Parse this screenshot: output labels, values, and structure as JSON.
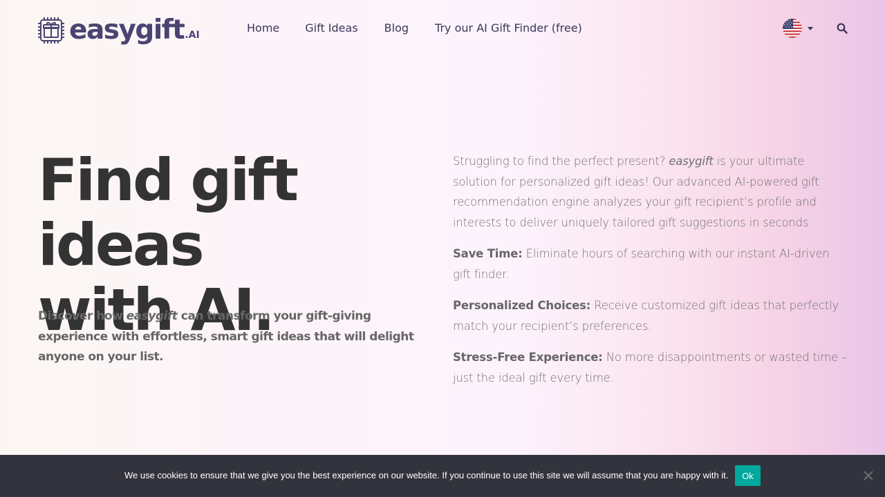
{
  "header": {
    "logo": {
      "word": "easygift",
      "suffix": ".AI"
    },
    "nav": [
      {
        "label": "Home"
      },
      {
        "label": "Gift Ideas"
      },
      {
        "label": "Blog"
      },
      {
        "label": "Try our AI Gift Finder (free)"
      }
    ],
    "language": {
      "icon": "us-flag-icon"
    },
    "search_icon": "search-icon"
  },
  "hero": {
    "title_line1": "Find gift ideas",
    "title_line2": "with AI.",
    "subtitle_pre": "Discover how ",
    "subtitle_brand": "easygift",
    "subtitle_post": " can transform your gift-giving experience with effortless, smart gift ideas that will delight anyone on your list."
  },
  "intro": {
    "p1_pre": "Struggling to find the perfect present? ",
    "p1_brand": "easygift",
    "p1_post": " is your ultimate solution for personalized gift ideas! Our advanced AI-powered gift recommendation engine analyzes your gift recipient’s profile and interests to deliver uniquely tailored gift suggestions in seconds.",
    "features": [
      {
        "label": "Save Time:",
        "text": " Eliminate hours of searching with our instant AI-driven gift finder."
      },
      {
        "label": "Personalized Choices:",
        "text": " Receive customized gift ideas that perfectly match your recipient’s preferences."
      },
      {
        "label": "Stress-Free Experience:",
        "text": " No more disappointments or wasted time – just the ideal gift every time."
      }
    ]
  },
  "cookie": {
    "text": "We use cookies to ensure that we give you the best experience on our website. If you continue to use this site we will assume that you are happy with it.",
    "ok_label": "Ok"
  },
  "colors": {
    "brand": "#4a4472",
    "heading": "#333333",
    "body_text": "#707070",
    "cookie_bg": "#32333c",
    "ok_button": "#00a99d"
  }
}
